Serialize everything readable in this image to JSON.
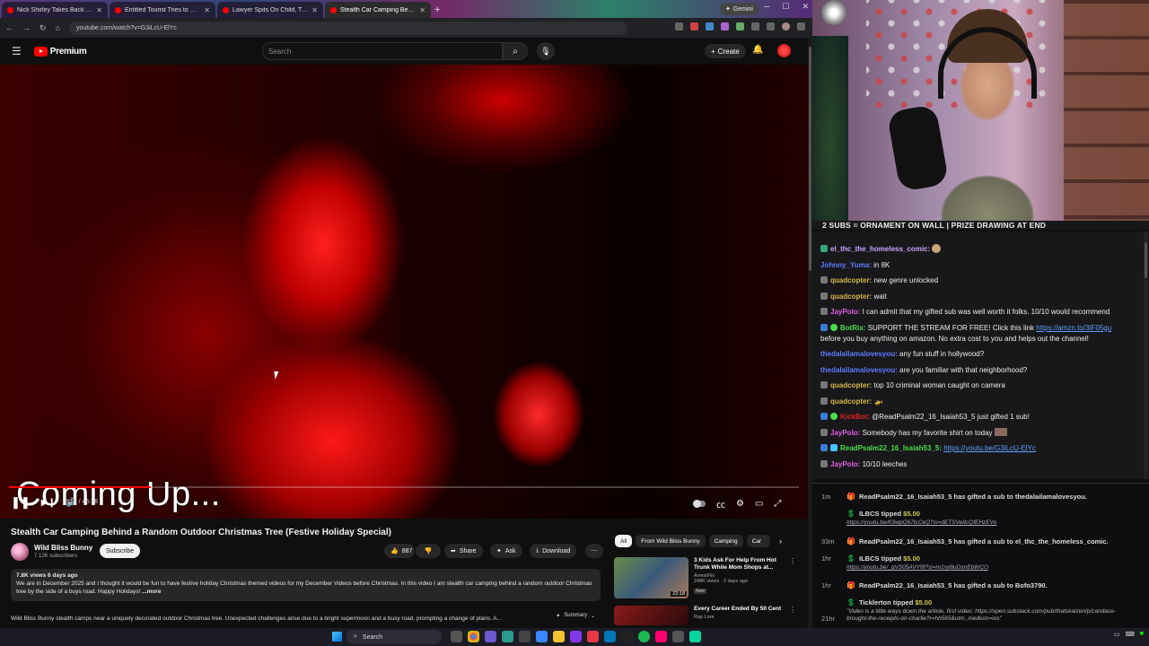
{
  "browser": {
    "tabs": [
      {
        "title": "Nick Shirley Takes Back Canal S",
        "active": false
      },
      {
        "title": "Entitled Tourist Tries to Murde",
        "active": false
      },
      {
        "title": "Lawyer Spits On Child, Then Tri",
        "active": false
      },
      {
        "title": "Stealth Car Camping Behin",
        "active": true
      }
    ],
    "gemini_label": "Gemini",
    "url": "youtube.com/watch?v=G3iLcU-ElYc"
  },
  "youtube": {
    "brand": "Premium",
    "search_placeholder": "Search",
    "create_label": "Create",
    "video": {
      "overlay_text": "Coming Up...",
      "time": "8:14 / 45:38",
      "progress": 0.18
    },
    "title": "Stealth Car Camping Behind a Random Outdoor Christmas Tree (Festive Holiday Special)",
    "channel": {
      "name": "Wild Bliss Bunny",
      "subscribers": "7.12K subscribers"
    },
    "subscribe_label": "Subscribe",
    "actions": {
      "likes": "887",
      "share": "Share",
      "ask": "Ask",
      "download": "Download"
    },
    "description": {
      "meta": "7.8K views  6 days ago",
      "text": "We are in December 2025 and I thought it would be fun to have festive holiday Christmas themed videos for my December Videos before Christmas.  In this video I am stealth car camping behind a random outdoor Christmas tree by the side of a buys road.  Happy Holidays!",
      "more": "...more"
    },
    "ai_summary": {
      "text": "Wild Bliss Bunny stealth camps near a uniquely decorated outdoor Christmas tree. Unexpected challenges arise due to a bright supermoon and a busy road, prompting a change of plans. A...",
      "button": "Summary"
    },
    "chips": [
      "All",
      "From Wild Bliss Bunny",
      "Camping",
      "Car"
    ],
    "recommendations": [
      {
        "title": "3 Kids Ask For Help From Hot Trunk While Mom Shops at...",
        "channel": "ArrestFlix",
        "meta": "248K views · 2 days ago",
        "badge": "New",
        "duration": "22:18"
      },
      {
        "title": "Every Career Ended By 50 Cent",
        "channel": "Rap Lore",
        "meta": "",
        "badge": "",
        "duration": ""
      }
    ]
  },
  "stream": {
    "banner": "2 SUBS = ORNAMENT ON WALL | PRIZE DRAWING AT END",
    "chat": [
      {
        "user": "el_thc_the_homeless_comic:",
        "text": "",
        "color": "#c9a4ff"
      },
      {
        "user": "Johnny_Yuma:",
        "text": "in 8K",
        "color": "#5f7cff"
      },
      {
        "user": "quadcopter:",
        "text": "new genre unlocked",
        "color": "#d6b94a"
      },
      {
        "user": "quadcopter:",
        "text": "wait",
        "color": "#d6b94a"
      },
      {
        "user": "JayPolo:",
        "text": "I can admit that my gifted sub was well worth it folks. 10/10 would recommend",
        "color": "#e060e0"
      },
      {
        "user": "BotRix:",
        "text": "SUPPORT THE STREAM FOR FREE! Click this link ",
        "link": "https://amzn.to/3tF05gu",
        "text2": "before you buy anything on amazon. No extra cost to you and helps out the channel!",
        "color": "#4adf4a"
      },
      {
        "user": "thedalailamalovesyou:",
        "text": "any fun stuff in hollywood?",
        "color": "#5f7cff"
      },
      {
        "user": "thedalailamalovesyou:",
        "text": "are you familiar with that neighborhood?",
        "color": "#5f7cff"
      },
      {
        "user": "quadcopter:",
        "text": "top 10 criminal woman caught on camera",
        "color": "#d6b94a"
      },
      {
        "user": "quadcopter:",
        "text": "",
        "color": "#d6b94a"
      },
      {
        "user": "KickBot:",
        "text": "@ReadPsalm22_16_Isaiah53_5 just gifted 1 sub!",
        "color": "#e02020"
      },
      {
        "user": "JayPolo:",
        "text": "Somebody has my favorite shirt on today",
        "color": "#e060e0"
      },
      {
        "user": "ReadPsalm22_16_Isaiah53_5:",
        "text": "",
        "link": "https://youtu.be/G3iLcU-ElYc",
        "color": "#4adf4a"
      },
      {
        "user": "JayPolo:",
        "text": "10/10 leeches",
        "color": "#e060e0"
      }
    ],
    "events": [
      {
        "time": "1m",
        "text": "ReadPsalm22_16_Isaiah53_5 has gifted a sub to thedalailamalovesyou.",
        "sub": ""
      },
      {
        "time": "",
        "text": "ILBCS tipped ",
        "amount": "$5.00",
        "sub": "https://youtu.be/K9wpQ67tcCeQ?si=dETSVe8cQfEHzEVo"
      },
      {
        "time": "33m",
        "text": "ReadPsalm22_16_Isaiah53_5 has gifted a sub to el_thc_the_homeless_comic.",
        "sub": ""
      },
      {
        "time": "1hr",
        "text": "ILBCS tipped ",
        "amount": "$5.00",
        "sub": "https://youtu.be/_qVS05AVYf8?si=m1ry8luDxnEbWCO"
      },
      {
        "time": "1hr",
        "text": "ReadPsalm22_16_Isaiah53_5 has gifted a sub to Bofo3790.",
        "sub": ""
      },
      {
        "time": "",
        "text": "Ticklerton tipped ",
        "amount": "$5.00",
        "sub": "\"Video is a little ways down the article, first video: https://open.substack.com/pub/thatskaizen/p/candace-brought-the-receipts-on-charlie?r=hh565&utm_medium=ios\""
      },
      {
        "time": "21hr",
        "text": "",
        "sub": ""
      }
    ]
  },
  "taskbar": {
    "search_placeholder": "Search"
  }
}
